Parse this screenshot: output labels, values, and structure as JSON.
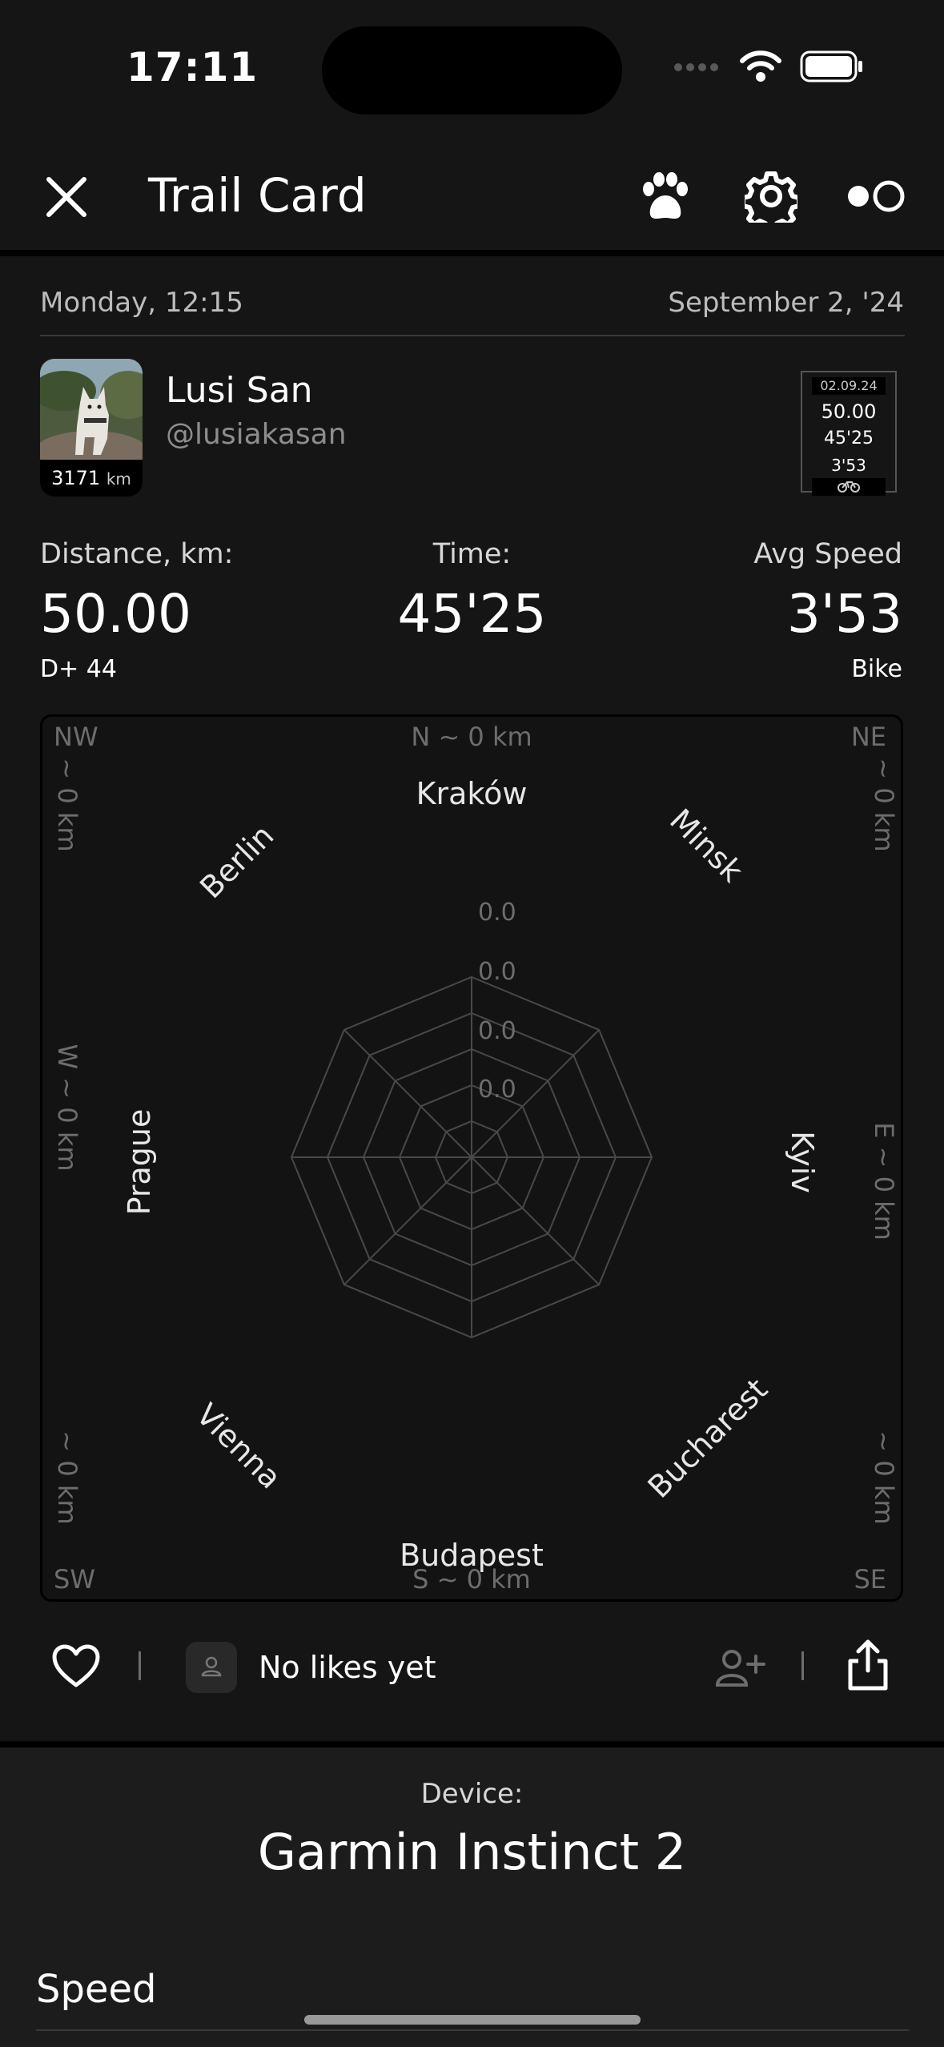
{
  "status": {
    "time": "17:11"
  },
  "appbar": {
    "title": "Trail Card"
  },
  "meta": {
    "day_time": "Monday, 12:15",
    "date": "September 2, '24"
  },
  "user": {
    "name": "Lusi San",
    "handle": "@lusiakasan",
    "total_km": "3171",
    "km_unit": "km"
  },
  "mini_card": {
    "date": "02.09.24",
    "distance": "50.00",
    "time": "45'25",
    "pace": "3'53"
  },
  "stats": {
    "distance_label": "Distance, km:",
    "distance_value": "50.00",
    "elevation": "D+ 44",
    "time_label": "Time:",
    "time_value": "45'25",
    "speed_label": "Avg Speed",
    "speed_value": "3'53",
    "activity": "Bike"
  },
  "radar": {
    "corners": {
      "nw": "NW",
      "ne": "NE",
      "sw": "SW",
      "se": "SE"
    },
    "north": "N ~ 0 km",
    "south": "S ~ 0 km",
    "west": "W ~ 0 km",
    "east": "E ~ 0 km",
    "nw_side": "~ 0 km",
    "ne_side": "~ 0 km",
    "sw_side": "~ 0 km",
    "se_side": "~ 0 km",
    "cities": [
      "Kraków",
      "Minsk",
      "Kyiv",
      "Bucharest",
      "Budapest",
      "Vienna",
      "Prague",
      "Berlin"
    ],
    "ring_labels": [
      "0.0",
      "0.0",
      "0.0",
      "0.0"
    ]
  },
  "social": {
    "likes_text": "No likes yet"
  },
  "device": {
    "label": "Device:",
    "name": "Garmin Instinct 2"
  },
  "section": {
    "speed": "Speed"
  },
  "colors": {
    "background": "#161516",
    "grid": "#4a494a",
    "muted": "#6e6d6e"
  }
}
